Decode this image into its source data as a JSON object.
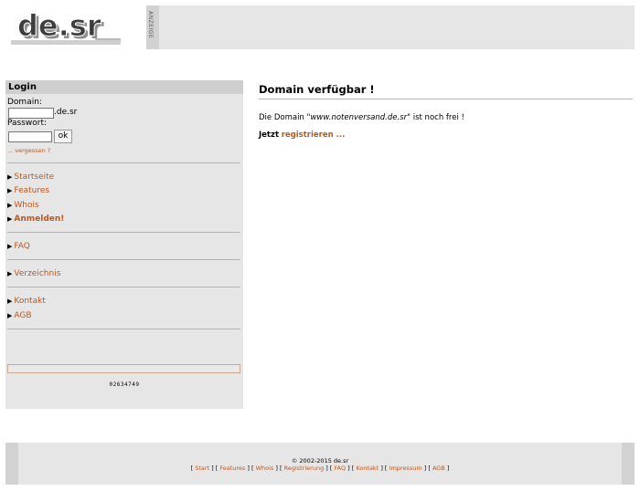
{
  "header": {
    "logo_text": "de.sr",
    "ad_label": "ANZEIGE"
  },
  "sidebar": {
    "login_title": "Login",
    "domain_label": "Domain:",
    "domain_value": "",
    "domain_suffix": ".de.sr",
    "password_label": "Passwort:",
    "password_value": "",
    "ok_label": "ok",
    "forgot_label": "... vergessen ?",
    "nav": [
      {
        "label": "Startseite"
      },
      {
        "label": "Features"
      },
      {
        "label": "Whois"
      },
      {
        "label": "Anmelden!"
      },
      {
        "label": "FAQ"
      },
      {
        "label": "Verzeichnis"
      },
      {
        "label": "Kontakt"
      },
      {
        "label": "AGB"
      }
    ],
    "counter": "02634749"
  },
  "main": {
    "title": "Domain verfügbar !",
    "line1_prefix": "Die Domain \"",
    "domain": "www.notenversand.de.sr",
    "line1_suffix": "\" ist noch frei !",
    "line2_prefix": "Jetzt",
    "register_link": "registrieren ..."
  },
  "footer": {
    "copyright": "© 2002-2015 de.sr",
    "links": [
      "Start",
      "Features",
      "Whois",
      "Registrierung",
      "FAQ",
      "Kontakt",
      "Impressum",
      "AGB"
    ]
  },
  "colors": {
    "link": "#c0561d",
    "panel": "#e6e6e6",
    "panel_header": "#cfcfcf"
  }
}
